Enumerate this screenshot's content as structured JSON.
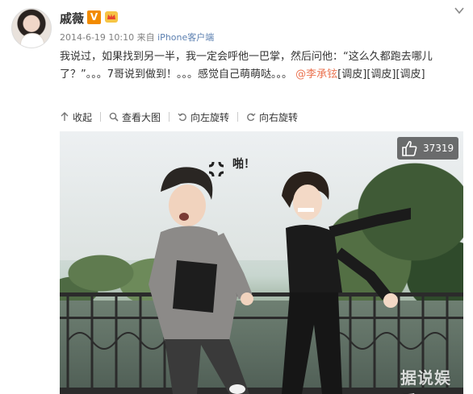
{
  "post": {
    "username": "戚薇",
    "verified_badge": "V",
    "timestamp": "2014-6-19 10:10",
    "source_prefix": "来自",
    "source": "iPhone客户端",
    "text_main": "我说过，如果找到另一半，我一定会呼他一巴掌，然后问他：“这么久都跑去哪儿了？”。。。7哥说到做到！。。。感觉自己萌萌哒。。。",
    "mention": "@李承铉",
    "emoticons": "[调皮][调皮][调皮]"
  },
  "toolbar": {
    "collapse_label": "收起",
    "view_large_label": "查看大图",
    "rotate_left_label": "向左旋转",
    "rotate_right_label": "向右旋转"
  },
  "photo": {
    "like_count": "37319",
    "caption_text": "啪！",
    "watermark": "据说娱乐"
  },
  "icons": {
    "header_menu": "chevron-down-icon",
    "badge_crown": "crown-icon",
    "like": "thumb-up-icon",
    "anger": "anger-symbol-icon"
  },
  "colors": {
    "link": "#eb7350",
    "meta": "#808080",
    "source": "#5b7fb0",
    "verified": "#f28b00"
  }
}
